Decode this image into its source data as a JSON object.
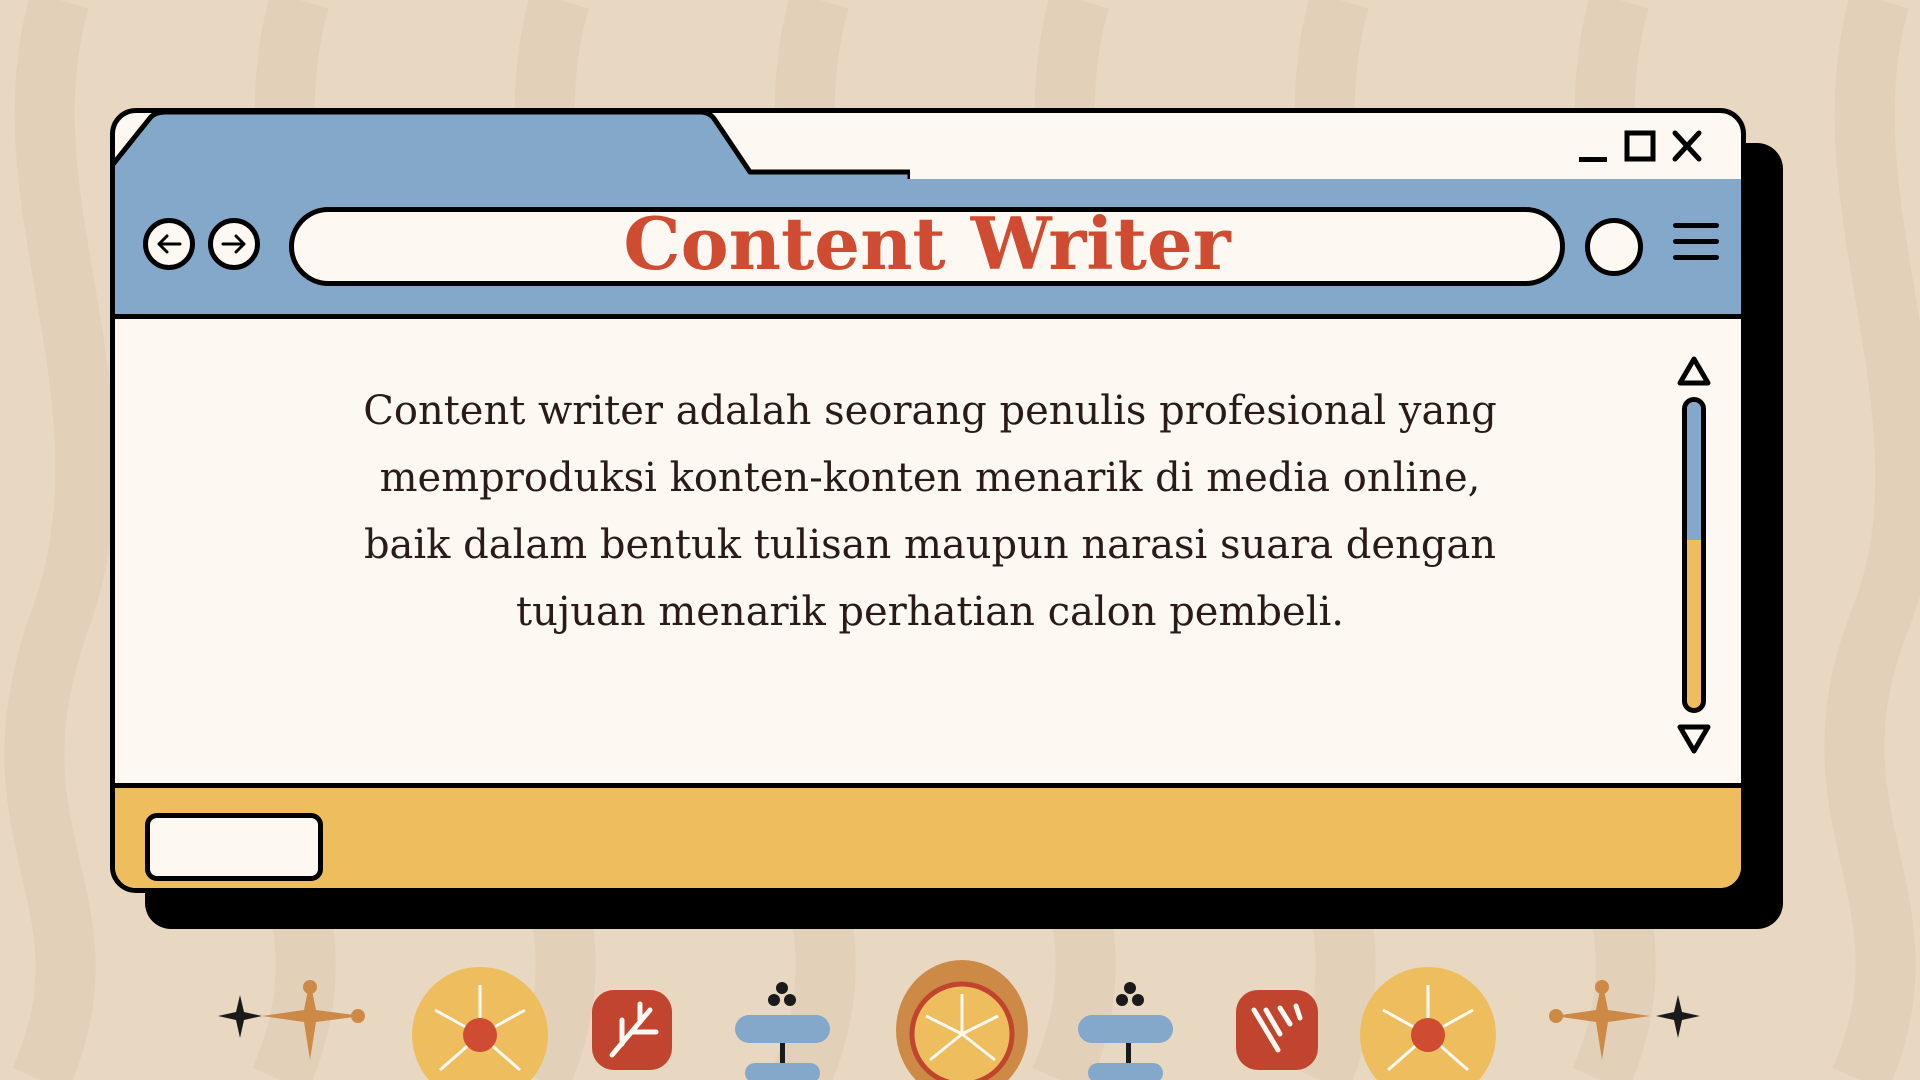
{
  "window": {
    "address_text": "Content Writer",
    "controls": {
      "minimize_icon": "minimize-icon",
      "maximize_icon": "maximize-icon",
      "close_icon": "close-icon"
    },
    "nav": {
      "back_icon": "arrow-left-icon",
      "forward_icon": "arrow-right-icon"
    },
    "menu_icon": "hamburger-menu-icon"
  },
  "content": {
    "paragraph": "Content writer adalah seorang penulis profesional yang memproduksi konten-konten menarik di media online, baik dalam bentuk tulisan maupun narasi suara dengan tujuan menarik perhatian calon pembeli."
  },
  "scrollbar": {
    "position_fraction": 0.45
  },
  "colors": {
    "background": "#e8d8c2",
    "titlebar": "#84a8c9",
    "window_body": "#fdf8f1",
    "footer": "#eebd5d",
    "title_text": "#cf4c33",
    "outline": "#000000"
  }
}
